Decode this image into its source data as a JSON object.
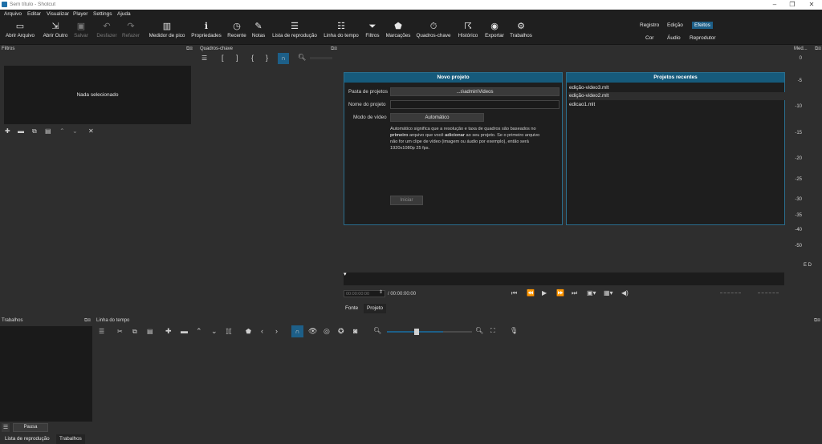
{
  "window": {
    "title": "Sem título - Shotcut",
    "controls": [
      "–",
      "❐",
      "✕"
    ]
  },
  "menu": [
    "Arquivo",
    "Editar",
    "Visualizar",
    "Player",
    "Settings",
    "Ajuda"
  ],
  "toolbar": [
    {
      "label": "Abrir Arquivo",
      "icon": "folder-icon",
      "glyph": "▭"
    },
    {
      "label": "Abrir Outro",
      "icon": "open-other-icon",
      "glyph": "⇲"
    },
    {
      "label": "Salvar",
      "icon": "save-icon",
      "glyph": "▣",
      "disabled": true
    },
    {
      "label": "Desfazer",
      "icon": "undo-icon",
      "glyph": "↶",
      "disabled": true
    },
    {
      "label": "Refazer",
      "icon": "redo-icon",
      "glyph": "↷",
      "disabled": true
    },
    {
      "label": "Medidor de pico",
      "icon": "peak-meter-icon",
      "glyph": "▥"
    },
    {
      "label": "Propriedades",
      "icon": "info-icon",
      "glyph": "ℹ"
    },
    {
      "label": "Recente",
      "icon": "clock-icon",
      "glyph": "◷"
    },
    {
      "label": "Notas",
      "icon": "notes-icon",
      "glyph": "✎"
    },
    {
      "label": "Lista de reprodução",
      "icon": "playlist-icon",
      "glyph": "☰"
    },
    {
      "label": "Linha do tempo",
      "icon": "timeline-icon",
      "glyph": "☷"
    },
    {
      "label": "Filtros",
      "icon": "filter-icon",
      "glyph": "⏷"
    },
    {
      "label": "Marcações",
      "icon": "marker-icon",
      "glyph": "⬟"
    },
    {
      "label": "Quadros-chave",
      "icon": "stopwatch-icon",
      "glyph": "⏱"
    },
    {
      "label": "Histórico",
      "icon": "history-icon",
      "glyph": "☈"
    },
    {
      "label": "Exportar",
      "icon": "export-icon",
      "glyph": "◉"
    },
    {
      "label": "Trabalhos",
      "icon": "gear-icon",
      "glyph": "⚙"
    }
  ],
  "layouts": {
    "row1": [
      "Registro",
      "Edição",
      "Efeitos"
    ],
    "row2": [
      "Cor",
      "Áudio",
      "Reprodutor"
    ],
    "active": "Efeitos"
  },
  "filters": {
    "title": "Filtros",
    "empty_text": "Nada selecionado",
    "dock_controls": "⧉⊠"
  },
  "keyframes": {
    "title": "Quadros-chave"
  },
  "meter": {
    "title": "Med...",
    "scale": [
      "0",
      "-5",
      "-10",
      "-15",
      "-20",
      "-25",
      "-30",
      "-35",
      "-40",
      "-50"
    ],
    "channels": "E  D"
  },
  "new_project": {
    "title": "Novo projeto",
    "folder_label": "Pasta de projetos",
    "folder_value": "...s\\admin\\Videos",
    "name_label": "Nome do projeto",
    "name_value": "",
    "mode_label": "Modo de vídeo",
    "mode_value": "Automático",
    "description_1": "Automático significa que a resolução e taxa de quadros são baseados no",
    "description_2a": "primeiro",
    "description_2b": " arquivo que você ",
    "description_2c": "adicionar",
    "description_2d": " ao seu projeto. Se o primeiro arquivo",
    "description_3": "não for um clipe de vídeo (imagem ou áudio por exemplo), então será",
    "description_4": "1920x1080p 25 fps.",
    "start_button": "Iniciar"
  },
  "recent_projects": {
    "title": "Projetos recentes",
    "items": [
      "edição-video3.mlt",
      "edição-video2.mlt",
      "edicao1.mlt"
    ]
  },
  "player": {
    "timecode": "00:00:00:00",
    "duration": "/ 00:00:00:00",
    "tabs": [
      "Fonte",
      "Projeto"
    ]
  },
  "jobs": {
    "title": "Trabalhos",
    "pause_button": "Pausa"
  },
  "timeline": {
    "title": "Linha do tempo"
  },
  "bottom_tabs": [
    "Lista de reprodução",
    "Trabalhos"
  ],
  "colors": {
    "accent": "#1d5f88",
    "panel_bg": "#1e1e1e",
    "header": "#165a7b"
  }
}
